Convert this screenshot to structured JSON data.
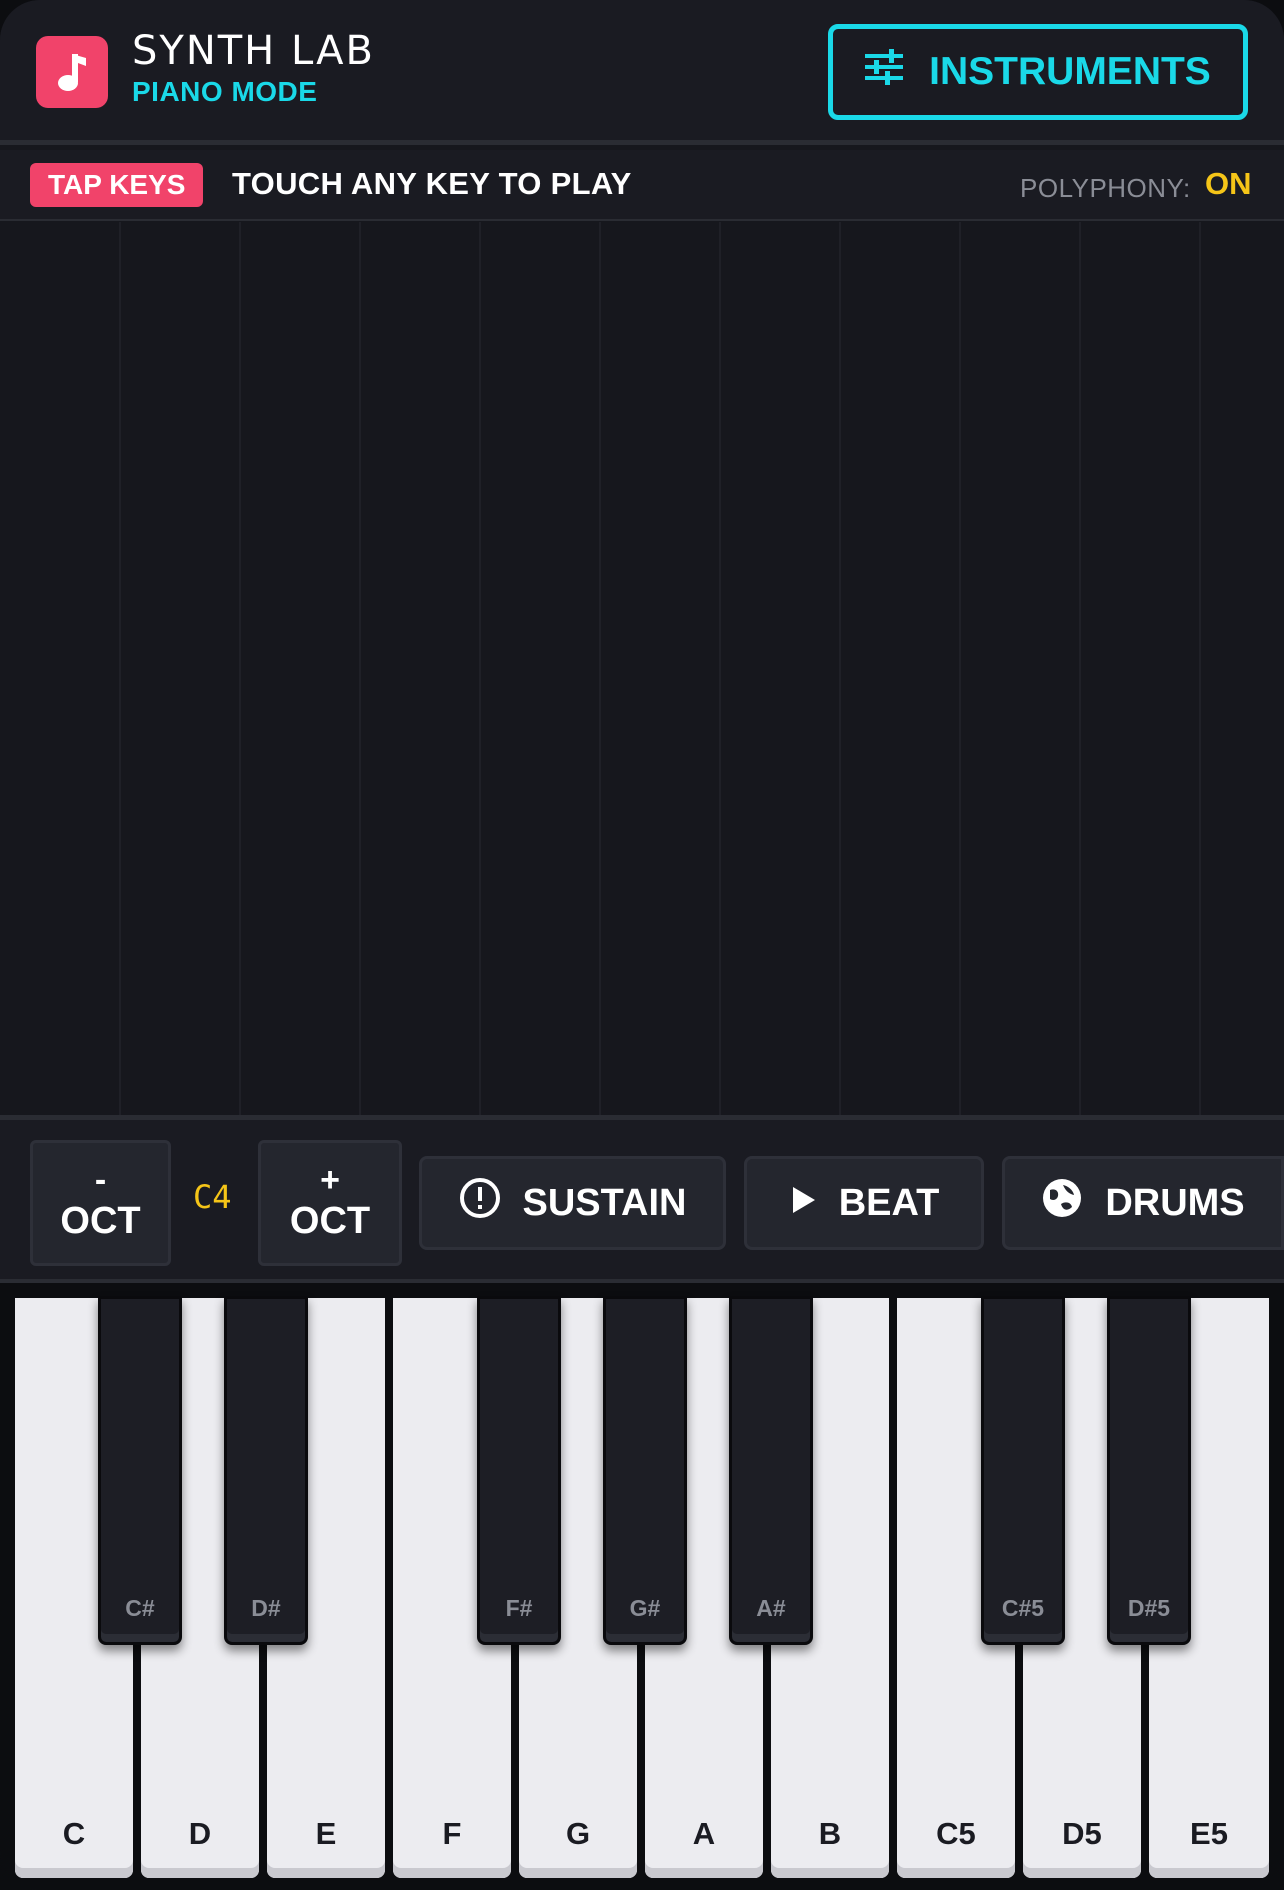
{
  "header": {
    "title": "SYNTH LAB",
    "subtitle": "PIANO MODE",
    "logo_icon": "music-note-icon",
    "instruments_label": "INSTRUMENTS",
    "instruments_icon": "sliders-icon"
  },
  "infobar": {
    "badge": "TAP KEYS",
    "hint": "TOUCH ANY KEY TO PLAY",
    "polyphony_label": "POLYPHONY:",
    "polyphony_value": "ON"
  },
  "controls": {
    "oct_down_sign": "-",
    "oct_down_label": "OCT",
    "octave_value": "C4",
    "oct_up_sign": "+",
    "oct_up_label": "OCT",
    "sustain_label": "SUSTAIN",
    "sustain_icon": "alert-circle-icon",
    "beat_label": "BEAT",
    "beat_icon": "play-icon",
    "drums_label": "DRUMS",
    "drums_icon": "drum-icon"
  },
  "piano": {
    "white_keys": [
      "C",
      "D",
      "E",
      "F",
      "G",
      "A",
      "B",
      "C5",
      "D5",
      "E5"
    ],
    "black_keys": [
      "C#",
      "D#",
      "F#",
      "G#",
      "A#",
      "C#5",
      "D#5"
    ]
  },
  "colors": {
    "accent_cyan": "#1ad9e8",
    "accent_pink": "#f1436a",
    "accent_yellow": "#f5c518",
    "background": "#16171d"
  }
}
